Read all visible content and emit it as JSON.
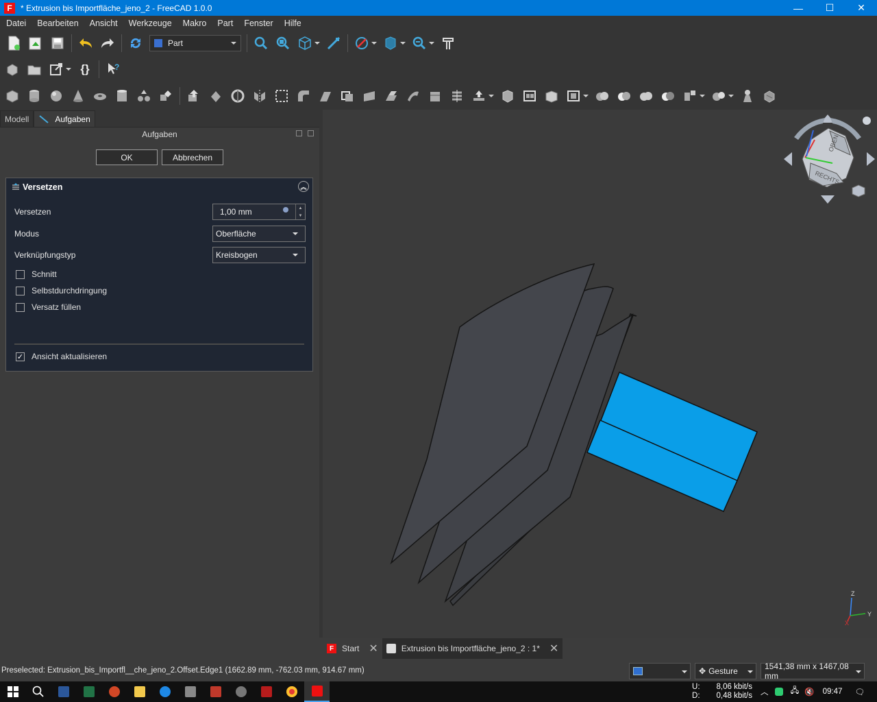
{
  "window": {
    "title": "* Extrusion bis Importfläche_jeno_2 - FreeCAD 1.0.0",
    "app_icon_letter": "F"
  },
  "menu": [
    "Datei",
    "Bearbeiten",
    "Ansicht",
    "Werkzeuge",
    "Makro",
    "Part",
    "Fenster",
    "Hilfe"
  ],
  "toolbar": {
    "workbench": "Part"
  },
  "left_panel": {
    "tabs": [
      "Modell",
      "Aufgaben"
    ],
    "header": "Aufgaben",
    "ok_label": "OK",
    "cancel_label": "Abbrechen",
    "task": {
      "title": "Versetzen",
      "offset_label": "Versetzen",
      "offset_value": "1,00 mm",
      "mode_label": "Modus",
      "mode_value": "Oberfläche",
      "join_label": "Verknüpfungstyp",
      "join_value": "Kreisbogen",
      "checkboxes": [
        {
          "label": "Schnitt",
          "checked": false
        },
        {
          "label": "Selbstdurchdringung",
          "checked": false
        },
        {
          "label": "Versatz füllen",
          "checked": false
        }
      ],
      "update_view_label": "Ansicht aktualisieren",
      "update_view_checked": true
    }
  },
  "navcube": {
    "top_face": "OBEN",
    "right_face": "RECHTS"
  },
  "axes": {
    "z": "Z",
    "y": "Y",
    "x": "X"
  },
  "doc_tabs": [
    {
      "label": "Start",
      "active": false
    },
    {
      "label": "Extrusion bis Importfläche_jeno_2 : 1*",
      "active": true
    }
  ],
  "status": {
    "message": "Preselected: Extrusion_bis_Importfl__che_jeno_2.Offset.Edge1 (1662.89 mm, -762.03 mm, 914.67 mm)",
    "nav_style": "Gesture",
    "dimensions": "1541,38 mm x 1467,08 mm"
  },
  "taskbar": {
    "net_up_label": "U:",
    "net_up": "8,06 kbit/s",
    "net_down_label": "D:",
    "net_down": "0,48 kbit/s",
    "clock": "09:47"
  },
  "colors": {
    "titlebar": "#0078d7",
    "selection_blue": "#0a9ee8",
    "shape_gray": "#3f4146"
  }
}
